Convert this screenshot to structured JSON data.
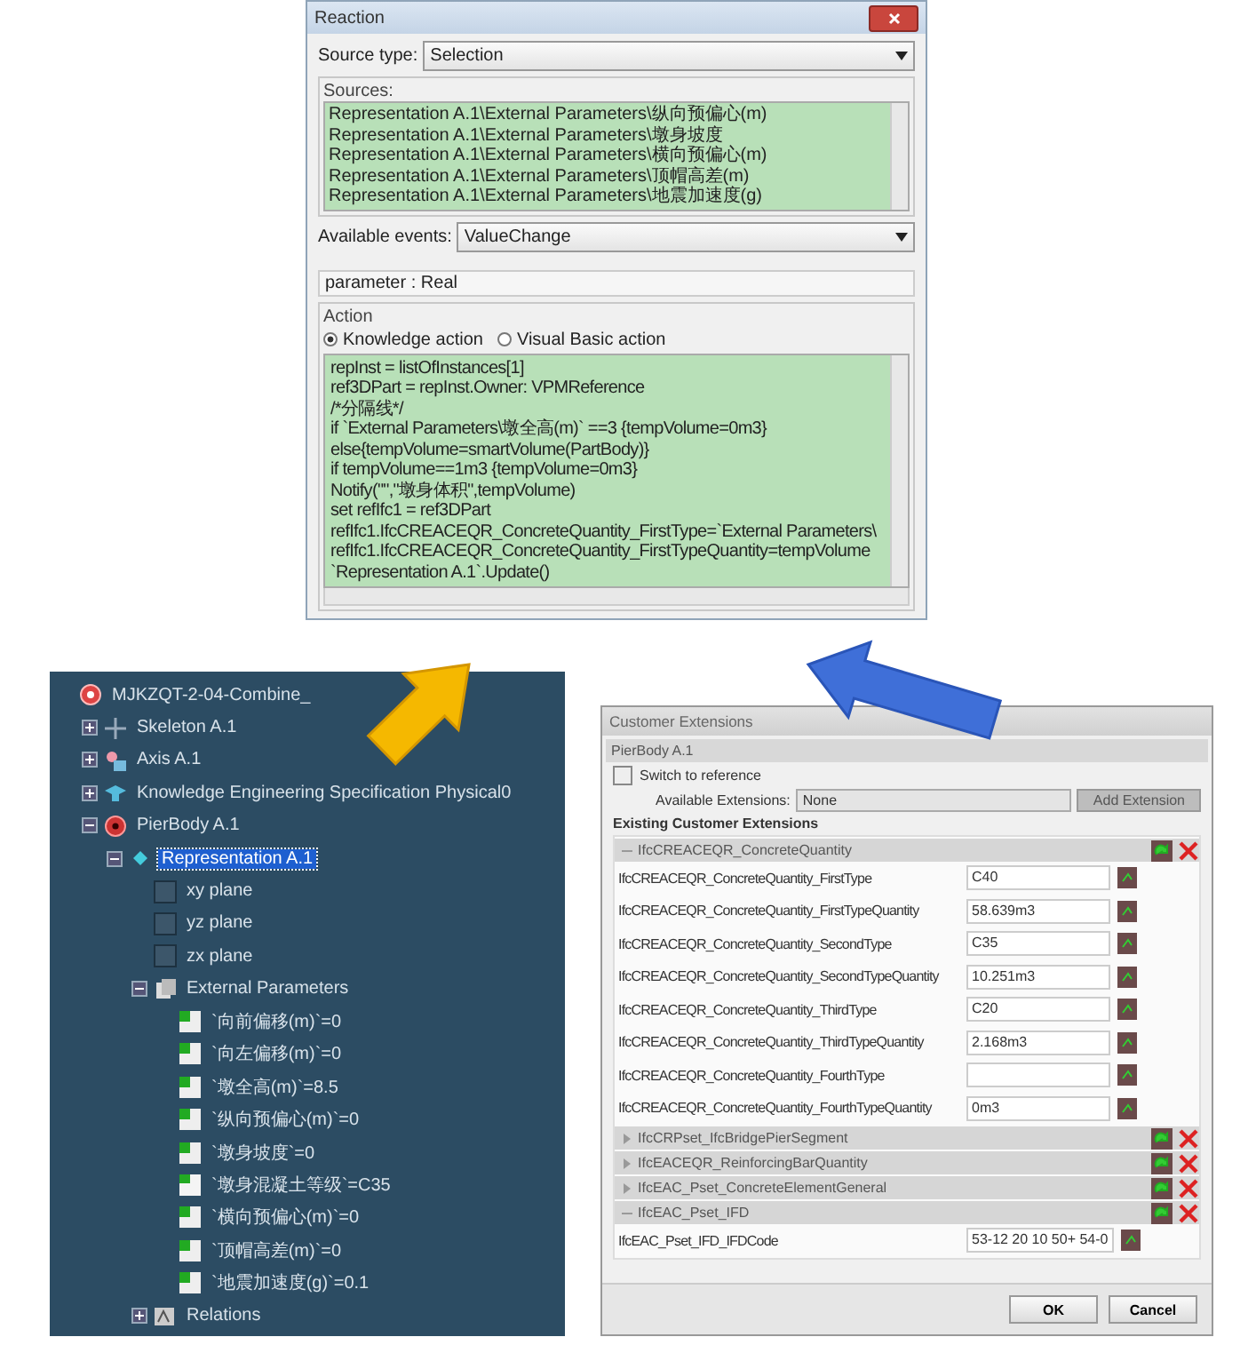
{
  "reaction": {
    "title": "Reaction",
    "source_type": {
      "label": "Source type:",
      "value": "Selection"
    },
    "sources": {
      "label": "Sources:",
      "items": [
        "Representation A.1\\External Parameters\\纵向预偏心(m)",
        "Representation A.1\\External Parameters\\墩身坡度",
        "Representation A.1\\External Parameters\\横向预偏心(m)",
        "Representation A.1\\External Parameters\\顶帽高差(m)",
        "Representation A.1\\External Parameters\\地震加速度(g)"
      ]
    },
    "events": {
      "label": "Available events:",
      "value": "ValueChange"
    },
    "parameter": "parameter : Real",
    "action": {
      "label": "Action",
      "options": [
        {
          "label": "Knowledge action",
          "selected": true
        },
        {
          "label": "Visual Basic action",
          "selected": false
        }
      ],
      "code": [
        "repInst = listOfInstances[1]",
        "ref3DPart = repInst.Owner: VPMReference",
        "/*分隔线*/",
        "if `External Parameters\\墩全高(m)` ==3 {tempVolume=0m3}",
        "else{tempVolume=smartVolume(PartBody)}",
        "if tempVolume==1m3 {tempVolume=0m3}",
        "Notify(\"\",\"墩身体积\",tempVolume)",
        "set refIfc1 = ref3DPart",
        "refIfc1.IfcCREACEQR_ConcreteQuantity_FirstType=`External Parameters\\",
        "refIfc1.IfcCREACEQR_ConcreteQuantity_FirstTypeQuantity=tempVolume",
        "`Representation A.1`.Update()"
      ]
    }
  },
  "tree": {
    "items": [
      {
        "label": "MJKZQT-2-04-Combine_",
        "kind": "product",
        "selected": false,
        "children": [
          {
            "label": "Skeleton A.1",
            "kind": "skeleton",
            "selected": false,
            "expanded": false
          },
          {
            "label": "Axis A.1",
            "kind": "axis",
            "selected": false,
            "expanded": false
          },
          {
            "label": "Knowledge Engineering Specification Physical0",
            "kind": "knowledge",
            "selected": false,
            "expanded": false
          },
          {
            "label": "PierBody A.1",
            "kind": "part",
            "selected": false,
            "expanded": true,
            "children": [
              {
                "label": "Representation A.1",
                "kind": "representation",
                "selected": true,
                "expanded": true,
                "children": [
                  {
                    "label": "xy plane",
                    "kind": "plane",
                    "selected": false
                  },
                  {
                    "label": "yz plane",
                    "kind": "plane",
                    "selected": false
                  },
                  {
                    "label": "zx plane",
                    "kind": "plane",
                    "selected": false
                  },
                  {
                    "label": "External Parameters",
                    "kind": "parameters",
                    "selected": false,
                    "expanded": true,
                    "children": [
                      {
                        "label": "`向前偏移(m)`=0",
                        "kind": "param",
                        "selected": false
                      },
                      {
                        "label": "`向左偏移(m)`=0",
                        "kind": "param",
                        "selected": false
                      },
                      {
                        "label": "`墩全高(m)`=8.5",
                        "kind": "param",
                        "selected": false
                      },
                      {
                        "label": "`纵向预偏心(m)`=0",
                        "kind": "param",
                        "selected": false
                      },
                      {
                        "label": "`墩身坡度`=0",
                        "kind": "param",
                        "selected": false
                      },
                      {
                        "label": "`墩身混凝土等级`=C35",
                        "kind": "text-param",
                        "selected": false
                      },
                      {
                        "label": "`横向预偏心(m)`=0",
                        "kind": "param",
                        "selected": false
                      },
                      {
                        "label": "`顶帽高差(m)`=0",
                        "kind": "param",
                        "selected": false
                      },
                      {
                        "label": "`地震加速度(g)`=0.1",
                        "kind": "param",
                        "selected": false
                      }
                    ]
                  },
                  {
                    "label": "Relations",
                    "kind": "relations",
                    "selected": false,
                    "expanded": false
                  }
                ]
              }
            ]
          }
        ]
      }
    ]
  },
  "extensions": {
    "title": "Customer Extensions",
    "object": "PierBody A.1",
    "switch": {
      "label": "Switch to reference",
      "checked": false
    },
    "available": {
      "label": "Available Extensions:",
      "value": "None"
    },
    "add_button": {
      "label": "Add Extension",
      "disabled": true
    },
    "section": "Existing Customer Extensions",
    "groups": [
      {
        "name": "IfcCREACEQR_ConcreteQuantity",
        "expanded": true,
        "fields": [
          {
            "name": "IfcCREACEQR_ConcreteQuantity_FirstType",
            "value": "C40"
          },
          {
            "name": "IfcCREACEQR_ConcreteQuantity_FirstTypeQuantity",
            "value": "58.639m3"
          },
          {
            "name": "IfcCREACEQR_ConcreteQuantity_SecondType",
            "value": "C35"
          },
          {
            "name": "IfcCREACEQR_ConcreteQuantity_SecondTypeQuantity",
            "value": "10.251m3"
          },
          {
            "name": "IfcCREACEQR_ConcreteQuantity_ThirdType",
            "value": "C20"
          },
          {
            "name": "IfcCREACEQR_ConcreteQuantity_ThirdTypeQuantity",
            "value": "2.168m3"
          },
          {
            "name": "IfcCREACEQR_ConcreteQuantity_FourthType"
          },
          {
            "name": "IfcCREACEQR_ConcreteQuantity_FourthTypeQuantity",
            "value": "0m3"
          }
        ]
      },
      {
        "name": "IfcCRPset_IfcBridgePierSegment",
        "expanded": false
      },
      {
        "name": "IfcEACEQR_ReinforcingBarQuantity",
        "expanded": false
      },
      {
        "name": "IfcEAC_Pset_ConcreteElementGeneral",
        "expanded": false
      },
      {
        "name": "IfcEAC_Pset_IFD",
        "expanded": true,
        "fields": [
          {
            "name": "IfcEAC_Pset_IFD_IFDCode",
            "value": "53-12 20 10 50+ 54-0"
          }
        ]
      }
    ],
    "buttons": [
      "OK",
      "Cancel"
    ]
  }
}
